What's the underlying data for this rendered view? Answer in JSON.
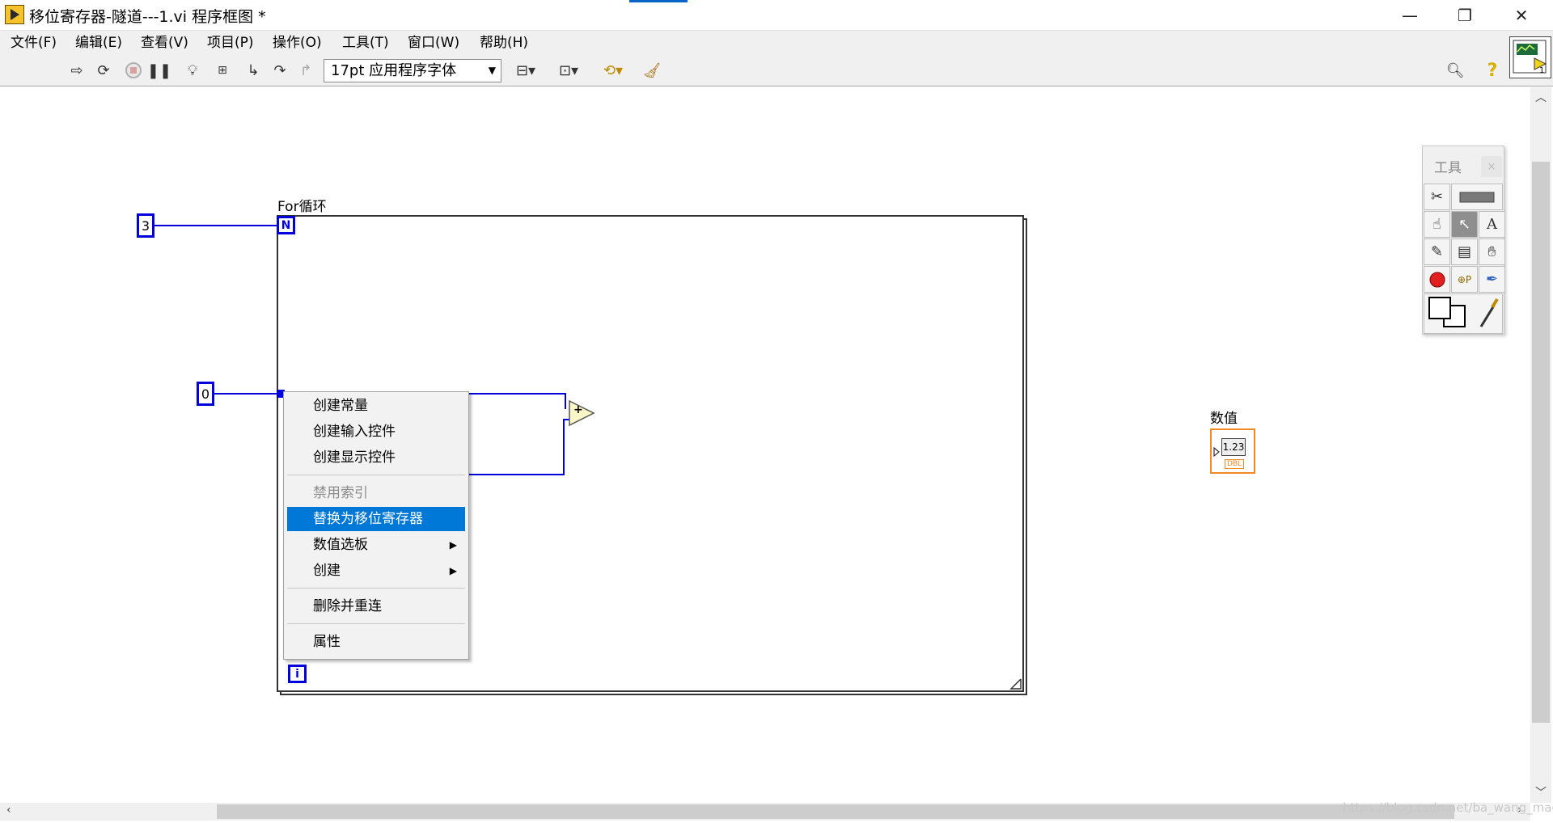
{
  "window": {
    "title": "移位寄存器-隧道---1.vi 程序框图 *",
    "minimize": "—",
    "restore": "❐",
    "close": "✕"
  },
  "menu": [
    "文件(F)",
    "编辑(E)",
    "查看(V)",
    "项目(P)",
    "操作(O)",
    "工具(T)",
    "窗口(W)",
    "帮助(H)"
  ],
  "toolbar": {
    "font_select": "17pt 应用程序字体",
    "icons": [
      "run-arrow-icon",
      "run-continuously-icon",
      "abort-icon",
      "pause-icon",
      "highlight-execution-icon",
      "retain-wire-values-icon",
      "step-into-icon",
      "step-over-icon",
      "step-out-icon",
      "align-objects-icon",
      "distribute-objects-icon",
      "reorder-icon",
      "clean-up-diagram-icon",
      "search-icon",
      "help-icon"
    ]
  },
  "diagram": {
    "loop_label": "For循环",
    "count_terminal": "N",
    "iteration_terminal": "i",
    "count_constant": "3",
    "init_constant": "0",
    "add_symbol": "+",
    "indicator_label": "数值",
    "indicator_value": "1.23",
    "indicator_type": "DBL"
  },
  "context_menu": {
    "items": [
      {
        "label": "创建常量",
        "state": "normal"
      },
      {
        "label": "创建输入控件",
        "state": "normal"
      },
      {
        "label": "创建显示控件",
        "state": "normal"
      },
      {
        "label": "禁用索引",
        "state": "disabled"
      },
      {
        "label": "替换为移位寄存器",
        "state": "selected"
      },
      {
        "label": "数值选板",
        "state": "submenu"
      },
      {
        "label": "创建",
        "state": "submenu"
      },
      {
        "label": "删除并重连",
        "state": "normal"
      },
      {
        "label": "属性",
        "state": "normal"
      }
    ]
  },
  "tools_palette": {
    "title": "工具",
    "close": "×"
  },
  "watermark": "https://blog.csdn.net/ba_wang_mao",
  "colors": {
    "wire": "#0000dc",
    "selection": "#0078d7",
    "dbl_indicator": "#f08a24"
  }
}
